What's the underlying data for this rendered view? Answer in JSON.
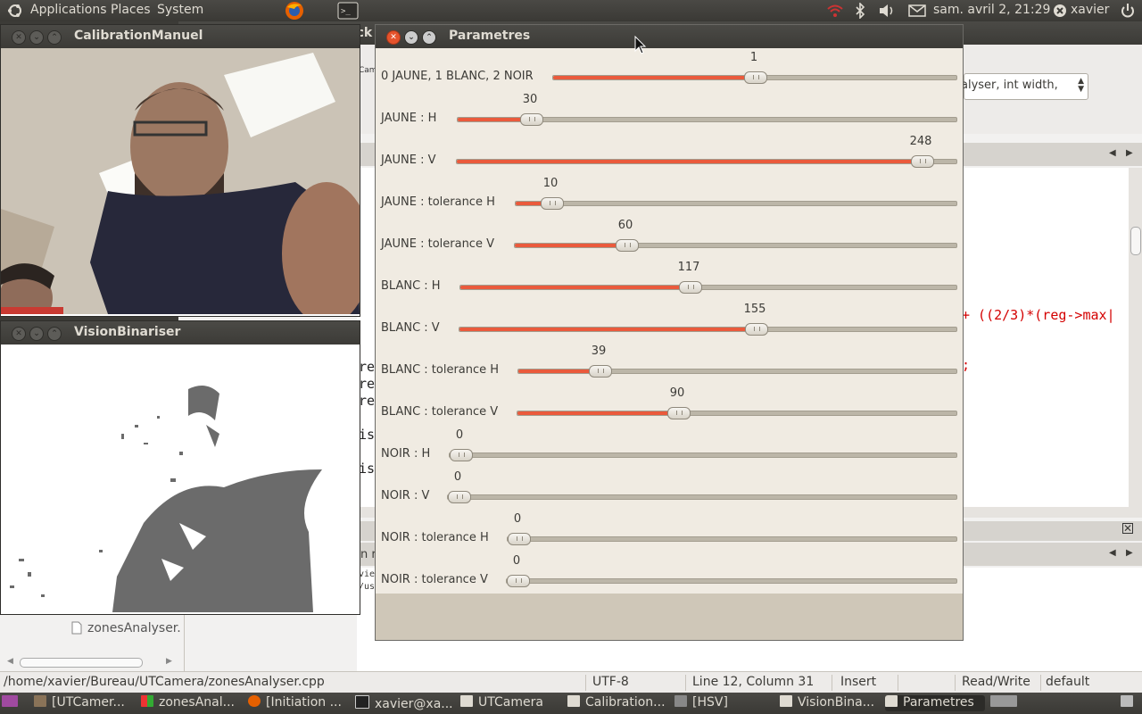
{
  "top_panel": {
    "menus": [
      "Applications",
      "Places",
      "System"
    ],
    "clock": "sam. avril  2, 21:29",
    "user": "xavier"
  },
  "editor": {
    "title_fragment": "ock",
    "tab_fragment": "Came",
    "combo_text": "alyser, int width,",
    "code_line": "+ ((2/3)*(reg->max|",
    "code_semicolon": ";",
    "left_code": [
      "reg",
      "reg",
      "reg",
      "ist",
      "ist"
    ],
    "bottom_tab": "n re",
    "bottom_lines": [
      "vie",
      "/us"
    ],
    "file_list_item": "zonesAnalyser.h"
  },
  "status_bar": {
    "path": "/home/xavier/Bureau/UTCamera/zonesAnalyser.cpp",
    "encoding": "UTF-8",
    "position": "Line 12, Column 31",
    "mode": "Insert",
    "access": "Read/Write",
    "profile": "default"
  },
  "windows": {
    "calibration": {
      "title": "CalibrationManuel"
    },
    "vision": {
      "title": "VisionBinariser"
    },
    "params": {
      "title": "Parametres"
    }
  },
  "sliders": [
    {
      "label": "0 JAUNE, 1 BLANC, 2 NOIR",
      "value": "1",
      "fraction": 0.5
    },
    {
      "label": "JAUNE : H",
      "value": "30",
      "fraction": 0.13
    },
    {
      "label": "JAUNE : V",
      "value": "248",
      "fraction": 0.95
    },
    {
      "label": "JAUNE : tolerance H",
      "value": "10",
      "fraction": 0.06
    },
    {
      "label": "JAUNE : tolerance V",
      "value": "60",
      "fraction": 0.24
    },
    {
      "label": "BLANC : H",
      "value": "117",
      "fraction": 0.46
    },
    {
      "label": "BLANC : V",
      "value": "155",
      "fraction": 0.6
    },
    {
      "label": "BLANC : tolerance H",
      "value": "39",
      "fraction": 0.17
    },
    {
      "label": "BLANC : tolerance V",
      "value": "90",
      "fraction": 0.36
    },
    {
      "label": "NOIR : H",
      "value": "0",
      "fraction": 0.0
    },
    {
      "label": "NOIR : V",
      "value": "0",
      "fraction": 0.0
    },
    {
      "label": "NOIR : tolerance H",
      "value": "0",
      "fraction": 0.0
    },
    {
      "label": "NOIR : tolerance V",
      "value": "0",
      "fraction": 0.0
    }
  ],
  "taskbar": {
    "items": [
      "[UTCamer...",
      "zonesAnal...",
      "[Initiation ...",
      "xavier@xa...",
      "UTCamera",
      "Calibration...",
      "[HSV]",
      "VisionBina...",
      "Parametres"
    ]
  },
  "colors": {
    "accent": "#ea5a3c",
    "panel": "#3c3b37",
    "dialog_bg": "#f0ebe2"
  }
}
